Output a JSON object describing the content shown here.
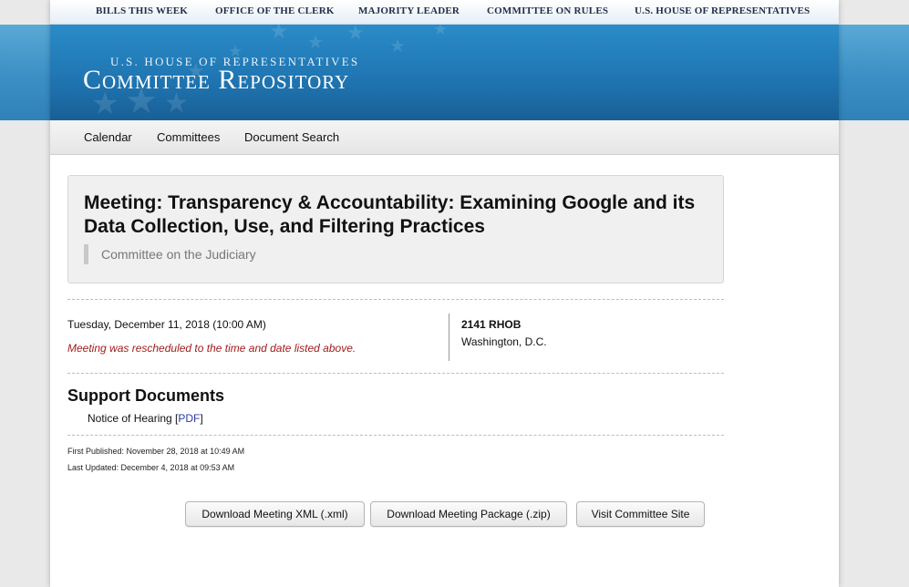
{
  "topbar": {
    "links": [
      "BILLS THIS WEEK",
      "OFFICE OF THE CLERK",
      "MAJORITY LEADER",
      "COMMITTEE ON RULES",
      "U.S. HOUSE OF REPRESENTATIVES"
    ]
  },
  "banner": {
    "subtitle": "U.S. House of Representatives",
    "title": "Committee Repository"
  },
  "nav": {
    "items": [
      "Calendar",
      "Committees",
      "Document Search"
    ]
  },
  "meeting": {
    "title": "Meeting: Transparency & Accountability: Examining Google and its Data Collection, Use, and Filtering Practices",
    "committee": "Committee on the Judiciary",
    "datetime": "Tuesday, December 11, 2018 (10:00 AM)",
    "note": "Meeting was rescheduled to the time and date listed above.",
    "room": "2141 RHOB",
    "city": "Washington, D.C."
  },
  "support": {
    "heading": "Support Documents",
    "doc_label": "Notice of Hearing [",
    "doc_link": "PDF",
    "doc_close": "]"
  },
  "meta": {
    "first_published": "First Published: November 28, 2018 at 10:49 AM",
    "last_updated": "Last Updated: December 4, 2018 at 09:53 AM"
  },
  "buttons": {
    "xml": "Download Meeting XML (.xml)",
    "zip": "Download Meeting Package (.zip)",
    "site": "Visit Committee Site"
  },
  "colors": {
    "banner": "#1f74b0",
    "note_red": "#a11c1c",
    "link_blue": "#2a3aa8"
  }
}
